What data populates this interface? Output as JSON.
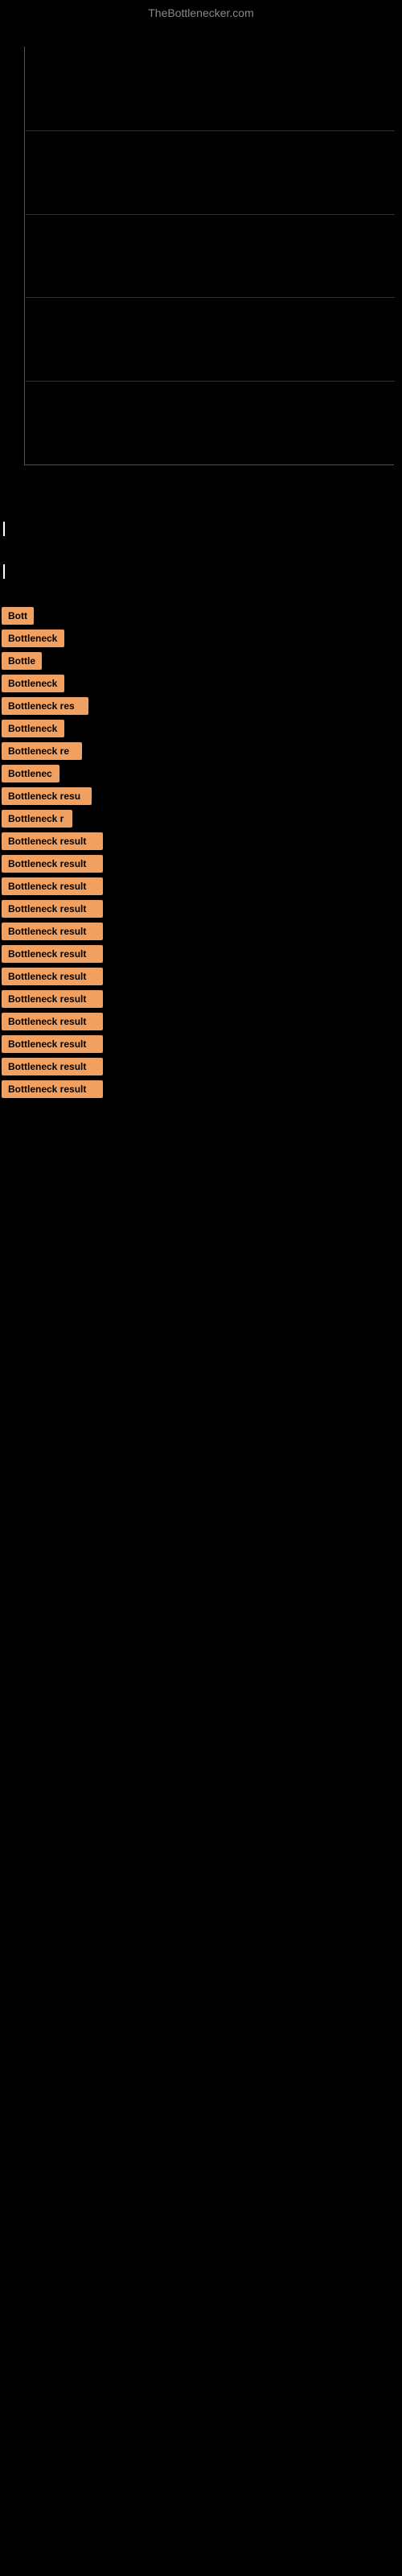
{
  "site": {
    "title": "TheBottlenecker.com"
  },
  "results": [
    {
      "label": "Bott",
      "width": 38
    },
    {
      "label": "Bottleneck",
      "width": 78
    },
    {
      "label": "Bottle",
      "width": 50
    },
    {
      "label": "Bottleneck",
      "width": 78
    },
    {
      "label": "Bottleneck res",
      "width": 108
    },
    {
      "label": "Bottleneck",
      "width": 78
    },
    {
      "label": "Bottleneck re",
      "width": 100
    },
    {
      "label": "Bottlenec",
      "width": 72
    },
    {
      "label": "Bottleneck resu",
      "width": 112
    },
    {
      "label": "Bottleneck r",
      "width": 88
    },
    {
      "label": "Bottleneck result",
      "width": 126
    },
    {
      "label": "Bottleneck result",
      "width": 126
    },
    {
      "label": "Bottleneck result",
      "width": 126
    },
    {
      "label": "Bottleneck result",
      "width": 126
    },
    {
      "label": "Bottleneck result",
      "width": 126
    },
    {
      "label": "Bottleneck result",
      "width": 126
    },
    {
      "label": "Bottleneck result",
      "width": 126
    },
    {
      "label": "Bottleneck result",
      "width": 126
    },
    {
      "label": "Bottleneck result",
      "width": 126
    },
    {
      "label": "Bottleneck result",
      "width": 126
    },
    {
      "label": "Bottleneck result",
      "width": 126
    },
    {
      "label": "Bottleneck result",
      "width": 126
    }
  ]
}
